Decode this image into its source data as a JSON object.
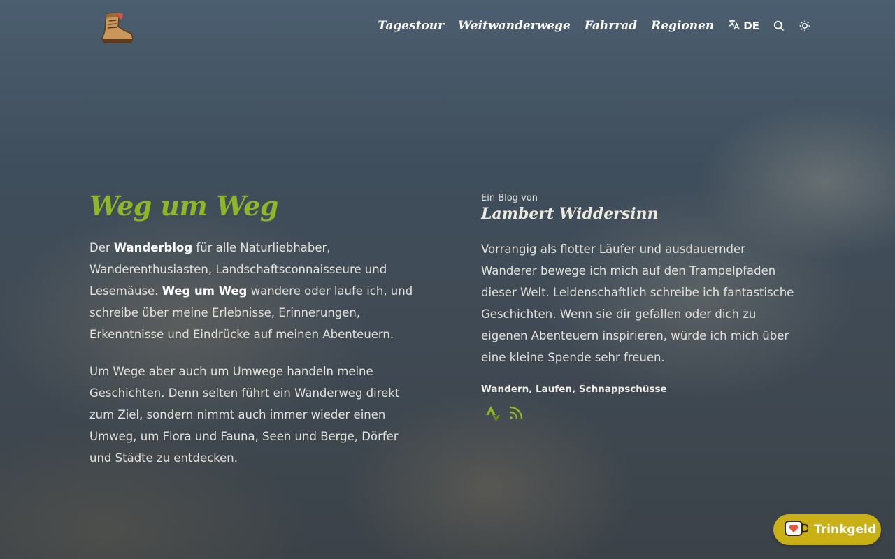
{
  "nav": {
    "logo_icon": "hiking-boot-icon",
    "items": [
      {
        "label": "Tagestour"
      },
      {
        "label": "Weitwanderwege"
      },
      {
        "label": "Fahrrad"
      },
      {
        "label": "Regionen"
      }
    ],
    "language_label": "DE",
    "language_icon": "translate-icon",
    "search_icon": "search-icon",
    "theme_icon": "sun-icon"
  },
  "hero": {
    "title": "Weg um Weg",
    "intro": {
      "p1_a": "Der ",
      "p1_b": "Wanderblog",
      "p1_c": " für alle Naturliebhaber, Wanderenthusiasten, Landschaftsconnaisseure und Lesemäuse. ",
      "p1_d": "Weg um Weg",
      "p1_e": " wandere oder laufe ich, und schreibe über meine Erlebnisse, Erinnerungen, Erkenntnisse und Eindrücke auf meinen Abenteuern.",
      "p2": "Um Wege aber auch um Umwege handeln meine Geschichten. Denn selten führt ein Wanderweg direkt zum Ziel, sondern nimmt auch immer wieder einen Umweg, um Flora und Fauna, Seen und Berge, Dörfer und Städte zu entdecken."
    }
  },
  "author": {
    "byline": "Ein Blog von",
    "name": "Lambert Widdersinn",
    "bio": "Vorrangig als flotter Läufer und ausdauernder Wanderer bewege ich mich auf den Trampelpfaden dieser Welt. Leidenschaftlich schreibe ich fantastische Geschichten. Wenn sie dir gefallen oder dich zu eigenen Abenteuern inspirieren, würde ich mich über eine kleine Spende sehr freuen.",
    "tags": "Wandern, Laufen, Schnappschüsse",
    "social": [
      {
        "icon": "strava-icon"
      },
      {
        "icon": "rss-icon"
      }
    ]
  },
  "tip_button": {
    "label": "Trinkgeld",
    "icon": "ko-fi-cup-icon"
  },
  "colors": {
    "accent": "#8fb528",
    "tip_button": "#c9b014"
  }
}
